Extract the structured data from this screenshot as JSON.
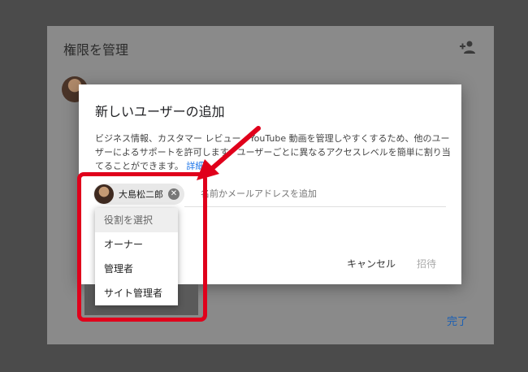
{
  "background_dialog": {
    "title": "権限を管理",
    "done_label": "完了"
  },
  "dialog": {
    "title": "新しいユーザーの追加",
    "description": "ビジネス情報、カスタマー レビュー、YouTube 動画を管理しやすくするため、他のユーザーによるサポートを許可します。ユーザーごとに異なるアクセスレベルを簡単に割り当てることができます。",
    "details_link": "詳細",
    "chip_name": "大島松二郎",
    "input_placeholder": "名前かメールアドレスを追加",
    "cancel_label": "キャンセル",
    "invite_label": "招待"
  },
  "role_menu": {
    "items": [
      {
        "label": "役割を選択"
      },
      {
        "label": "オーナー"
      },
      {
        "label": "管理者"
      },
      {
        "label": "サイト管理者"
      }
    ]
  },
  "colors": {
    "accent": "#1a73e8",
    "highlight": "#e0001b"
  }
}
